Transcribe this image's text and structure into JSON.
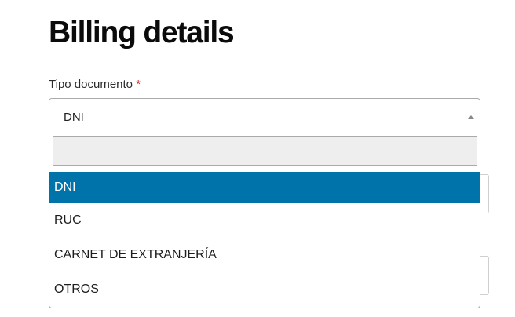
{
  "page": {
    "title": "Billing details"
  },
  "field": {
    "label": "Tipo documento",
    "required_mark": "*",
    "selected_value": "DNI",
    "search_value": ""
  },
  "dropdown": {
    "options": [
      {
        "label": "DNI",
        "highlighted": true
      },
      {
        "label": "RUC",
        "highlighted": false
      },
      {
        "label": "CARNET DE EXTRANJERÍA",
        "highlighted": false
      },
      {
        "label": "OTROS",
        "highlighted": false
      }
    ],
    "arrow_icon": "caret-up-icon"
  },
  "colors": {
    "highlight": "#0073aa",
    "required": "#d11a1a"
  }
}
